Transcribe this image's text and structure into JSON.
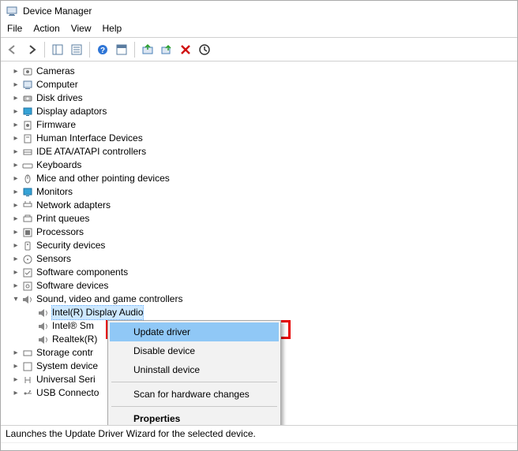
{
  "window": {
    "title": "Device Manager"
  },
  "menu": {
    "file": "File",
    "action": "Action",
    "view": "View",
    "help": "Help"
  },
  "tree": {
    "items": [
      {
        "label": "Cameras"
      },
      {
        "label": "Computer"
      },
      {
        "label": "Disk drives"
      },
      {
        "label": "Display adaptors"
      },
      {
        "label": "Firmware"
      },
      {
        "label": "Human Interface Devices"
      },
      {
        "label": "IDE ATA/ATAPI controllers"
      },
      {
        "label": "Keyboards"
      },
      {
        "label": "Mice and other pointing devices"
      },
      {
        "label": "Monitors"
      },
      {
        "label": "Network adapters"
      },
      {
        "label": "Print queues"
      },
      {
        "label": "Processors"
      },
      {
        "label": "Security devices"
      },
      {
        "label": "Sensors"
      },
      {
        "label": "Software components"
      },
      {
        "label": "Software devices"
      }
    ],
    "expanded": {
      "label": "Sound, video and game controllers",
      "children": [
        {
          "label": "Intel(R) Display Audio",
          "selected": true
        },
        {
          "label": "Intel® Sm"
        },
        {
          "label": "Realtek(R)"
        }
      ]
    },
    "after": [
      {
        "label": "Storage contr"
      },
      {
        "label": "System device"
      },
      {
        "label": "Universal Seri"
      },
      {
        "label": "USB Connecto"
      }
    ]
  },
  "context_menu": {
    "update": "Update driver",
    "disable": "Disable device",
    "uninstall": "Uninstall device",
    "scan": "Scan for hardware changes",
    "properties": "Properties"
  },
  "status": "Launches the Update Driver Wizard for the selected device."
}
